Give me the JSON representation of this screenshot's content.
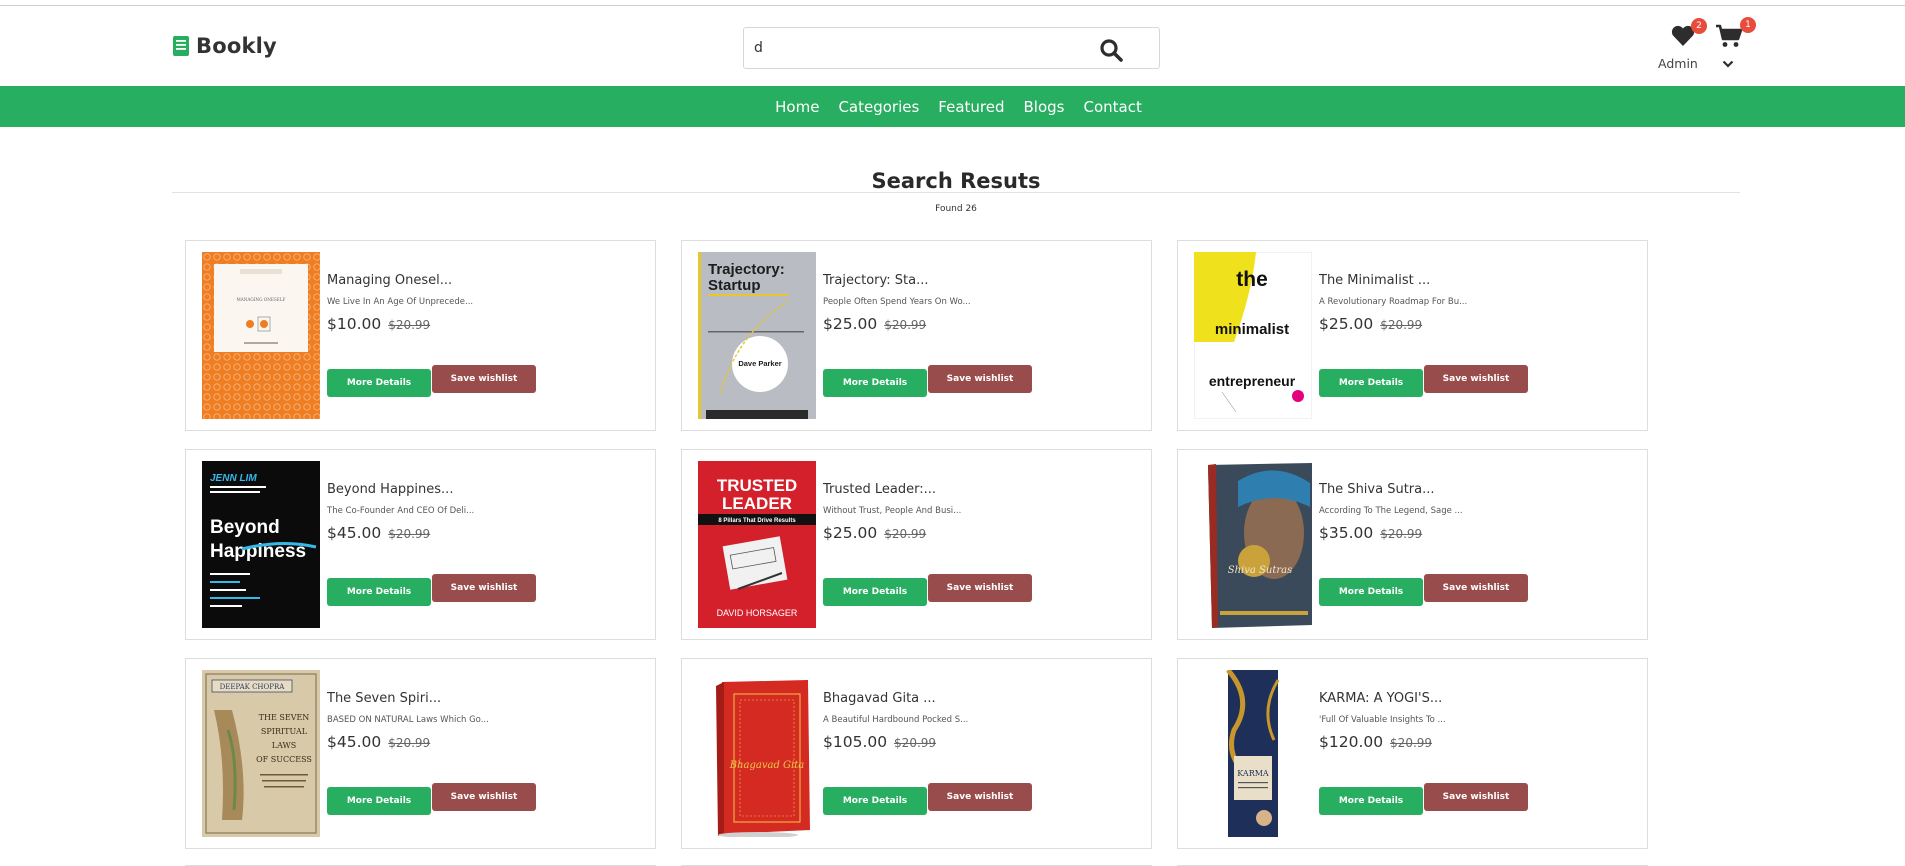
{
  "brand": {
    "name": "Bookly"
  },
  "search": {
    "value": "d",
    "placeholder": ""
  },
  "user": {
    "name": "Admin",
    "wishlist_count": "2",
    "cart_count": "1"
  },
  "nav": [
    {
      "label": "Home"
    },
    {
      "label": "Categories"
    },
    {
      "label": "Featured"
    },
    {
      "label": "Blogs"
    },
    {
      "label": "Contact"
    }
  ],
  "results": {
    "title": "Search Resuts",
    "count_label": "Found 26"
  },
  "books": [
    {
      "title": "Managing Onesel...",
      "desc": "We Live In An Age Of Unprecede...",
      "price": "$10.00",
      "old_price": "$20.99",
      "more_label": "More Details",
      "wish_label": "Save wishlist"
    },
    {
      "title": "Trajectory: Sta...",
      "desc": "People Often Spend Years On Wo...",
      "price": "$25.00",
      "old_price": "$20.99",
      "more_label": "More Details",
      "wish_label": "Save wishlist"
    },
    {
      "title": "The Minimalist ...",
      "desc": "A Revolutionary Roadmap For Bu...",
      "price": "$25.00",
      "old_price": "$20.99",
      "more_label": "More Details",
      "wish_label": "Save wishlist"
    },
    {
      "title": "Beyond Happines...",
      "desc": "The Co-Founder And CEO Of Deli...",
      "price": "$45.00",
      "old_price": "$20.99",
      "more_label": "More Details",
      "wish_label": "Save wishlist"
    },
    {
      "title": "Trusted Leader:...",
      "desc": "Without Trust, People And Busi...",
      "price": "$25.00",
      "old_price": "$20.99",
      "more_label": "More Details",
      "wish_label": "Save wishlist"
    },
    {
      "title": "The Shiva Sutra...",
      "desc": "According To The Legend, Sage ...",
      "price": "$35.00",
      "old_price": "$20.99",
      "more_label": "More Details",
      "wish_label": "Save wishlist"
    },
    {
      "title": "The Seven Spiri...",
      "desc": "BASED ON NATURAL Laws Which Go...",
      "price": "$45.00",
      "old_price": "$20.99",
      "more_label": "More Details",
      "wish_label": "Save wishlist"
    },
    {
      "title": "Bhagavad Gita ...",
      "desc": "A Beautiful Hardbound Pocked S...",
      "price": "$105.00",
      "old_price": "$20.99",
      "more_label": "More Details",
      "wish_label": "Save wishlist"
    },
    {
      "title": "KARMA: A YOGI'S...",
      "desc": "'Full Of Valuable Insights To ...",
      "price": "$120.00",
      "old_price": "$20.99",
      "more_label": "More Details",
      "wish_label": "Save wishlist"
    }
  ],
  "covers": {
    "trajectory": {
      "line1": "Trajectory:",
      "line2": "Startup",
      "author": "Dave Parker"
    },
    "minimalist": {
      "line1": "the",
      "line2": "minimalist",
      "line3": "entrepreneur"
    },
    "beyond": {
      "author": "JENN LIM",
      "line1": "Beyond",
      "line2": "Happiness"
    },
    "trusted": {
      "line1": "TRUSTED",
      "line2": "LEADER",
      "sub": "8 Pillars That Drive Results",
      "author": "DAVID HORSAGER"
    },
    "seven": {
      "author": "DEEPAK CHOPRA",
      "line1": "THE SEVEN",
      "line2": "SPIRITUAL",
      "line3": "LAWS",
      "line4": "OF SUCCESS"
    },
    "managing": {
      "label": "MANAGING ONESELF"
    },
    "shiva": {
      "label": "Shiva Sutras"
    },
    "gita": {
      "label": "Bhagavad Gita"
    },
    "karma": {
      "label": "KARMA"
    }
  }
}
